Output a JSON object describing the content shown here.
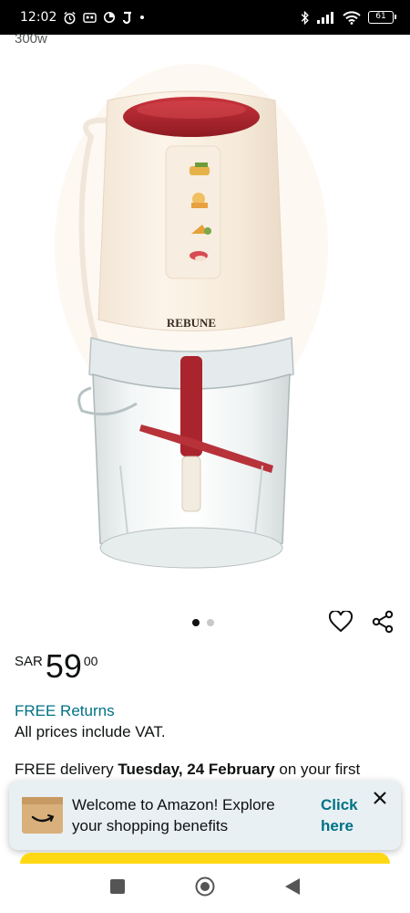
{
  "status_bar": {
    "time": "12:02",
    "battery": "61",
    "icons": [
      "alarm-icon",
      "cast-icon",
      "data-saver-icon",
      "j-app-icon",
      "dot-icon",
      "bluetooth-icon",
      "signal-icon",
      "wifi-icon",
      "battery-icon"
    ]
  },
  "product": {
    "title_fragment": "300w",
    "brand_label": "REBUNE",
    "image_count": 2,
    "active_image": 1
  },
  "actions": {
    "wishlist_icon": "heart-outline-icon",
    "share_icon": "share-icon"
  },
  "price": {
    "currency": "SAR",
    "whole": "59",
    "fraction": "00"
  },
  "returns": {
    "label": "FREE Returns"
  },
  "vat_note": "All prices include VAT.",
  "delivery": {
    "prefix": "FREE delivery ",
    "date": "Tuesday, 24 February",
    "suffix": " on your first"
  },
  "welcome_banner": {
    "icon": "amazon-box-icon",
    "text": "Welcome to Amazon! Explore your shopping benefits",
    "link": "Click here",
    "close_icon": "close-icon"
  },
  "colors": {
    "link": "#007185",
    "banner_bg": "#e9f0f4",
    "buy_button": "#ffd814",
    "status_bar_bg": "#000000"
  },
  "nav_bar": {
    "icons": [
      "recents-square-icon",
      "home-circle-icon",
      "back-triangle-icon"
    ]
  }
}
